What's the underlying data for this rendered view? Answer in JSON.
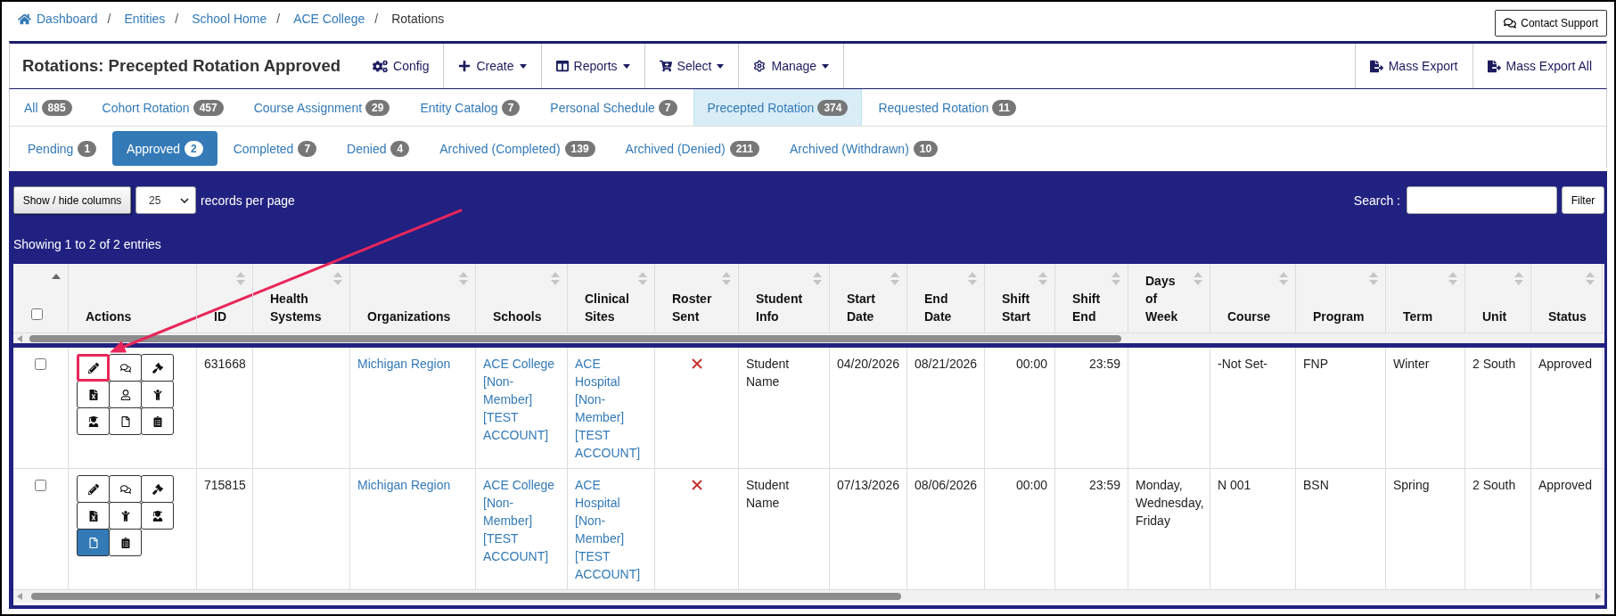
{
  "breadcrumb": [
    {
      "kind": "home",
      "label": "Dashboard"
    },
    {
      "kind": "separator",
      "label": "/"
    },
    {
      "kind": "link",
      "label": "Entities"
    },
    {
      "kind": "separator",
      "label": "/"
    },
    {
      "kind": "link",
      "label": "School Home"
    },
    {
      "kind": "separator",
      "label": "/"
    },
    {
      "kind": "link",
      "label": "ACE College"
    },
    {
      "kind": "separator",
      "label": "/"
    },
    {
      "kind": "current",
      "label": "Rotations"
    }
  ],
  "contact_support": {
    "label": "Contact Support"
  },
  "toolbar": {
    "title": "Rotations: Precepted Rotation Approved",
    "menus": [
      {
        "kind": "config",
        "label": "Config",
        "dropdown": false
      },
      {
        "kind": "create",
        "label": "Create",
        "dropdown": true
      },
      {
        "kind": "reports",
        "label": "Reports",
        "dropdown": true
      },
      {
        "kind": "select",
        "label": "Select",
        "dropdown": true
      },
      {
        "kind": "manage",
        "label": "Manage",
        "dropdown": true
      }
    ],
    "exports": [
      {
        "label": "Mass Export"
      },
      {
        "label": "Mass Export All"
      }
    ]
  },
  "type_tabs": [
    {
      "label": "All",
      "count": "885",
      "selected": false
    },
    {
      "label": "Cohort Rotation",
      "count": "457",
      "selected": false
    },
    {
      "label": "Course Assignment",
      "count": "29",
      "selected": false
    },
    {
      "label": "Entity Catalog",
      "count": "7",
      "selected": false
    },
    {
      "label": "Personal Schedule",
      "count": "7",
      "selected": false
    },
    {
      "label": "Precepted Rotation",
      "count": "374",
      "selected": true
    },
    {
      "label": "Requested Rotation",
      "count": "11",
      "selected": false
    }
  ],
  "status_tabs": [
    {
      "label": "Pending",
      "count": "1",
      "selected": false
    },
    {
      "label": "Approved",
      "count": "2",
      "selected": true
    },
    {
      "label": "Completed",
      "count": "7",
      "selected": false
    },
    {
      "label": "Denied",
      "count": "4",
      "selected": false
    },
    {
      "label": "Archived (Completed)",
      "count": "139",
      "selected": false
    },
    {
      "label": "Archived (Denied)",
      "count": "211",
      "selected": false
    },
    {
      "label": "Archived (Withdrawn)",
      "count": "10",
      "selected": false
    }
  ],
  "table_controls": {
    "columns_button": "Show / hide columns",
    "page_size": "25",
    "page_size_label": "records per page",
    "search_label": "Search :",
    "filter_button": "Filter"
  },
  "info": "Showing 1 to 2 of 2 entries",
  "table": {
    "select_all": {
      "checked": false,
      "sorted": true
    },
    "columns": [
      {
        "label": "Actions",
        "sortable": false,
        "sorted": false
      },
      {
        "label": "ID",
        "sortable": true,
        "sorted": false
      },
      {
        "label": "Health Systems",
        "sortable": true,
        "sorted": false
      },
      {
        "label": "Organizations",
        "sortable": true,
        "sorted": false
      },
      {
        "label": "Schools",
        "sortable": true,
        "sorted": false
      },
      {
        "label": "Clinical Sites",
        "sortable": true,
        "sorted": false
      },
      {
        "label": "Roster Sent",
        "sortable": true,
        "sorted": false
      },
      {
        "label": "Student Info",
        "sortable": true,
        "sorted": false
      },
      {
        "label": "Start Date",
        "sortable": true,
        "sorted": false
      },
      {
        "label": "End Date",
        "sortable": true,
        "sorted": false
      },
      {
        "label": "Shift Start",
        "sortable": true,
        "sorted": false
      },
      {
        "label": "Shift End",
        "sortable": true,
        "sorted": false
      },
      {
        "label": "Days of Week",
        "sortable": true,
        "sorted": false
      },
      {
        "label": "Course",
        "sortable": true,
        "sorted": false
      },
      {
        "label": "Program",
        "sortable": true,
        "sorted": false
      },
      {
        "label": "Term",
        "sortable": true,
        "sorted": false
      },
      {
        "label": "Unit",
        "sortable": true,
        "sorted": false
      },
      {
        "label": "Status",
        "sortable": true,
        "sorted": false
      }
    ],
    "rows": [
      {
        "checked": false,
        "actions": [
          {
            "kind": "edit",
            "active": false,
            "highlighted": true
          },
          {
            "kind": "comments",
            "active": false,
            "highlighted": false
          },
          {
            "kind": "gavel",
            "active": false,
            "highlighted": false
          },
          {
            "kind": "excel",
            "active": false,
            "highlighted": false
          },
          {
            "kind": "user",
            "active": false,
            "highlighted": false
          },
          {
            "kind": "child",
            "active": false,
            "highlighted": false
          },
          {
            "kind": "graduate",
            "active": false,
            "highlighted": false
          },
          {
            "kind": "file",
            "active": false,
            "highlighted": false
          },
          {
            "kind": "clipboard",
            "active": false,
            "highlighted": false
          }
        ],
        "id": "631668",
        "organization": "Michigan Region",
        "school": "ACE College [Non-Member] [TEST ACCOUNT]",
        "clinical_site": "ACE Hospital [Non-Member] [TEST ACCOUNT]",
        "roster_sent": false,
        "student_info": "Student Name",
        "start_date": "04/20/2026",
        "end_date": "08/21/2026",
        "shift_start": "00:00",
        "shift_end": "23:59",
        "course": "-Not Set-",
        "program": "FNP",
        "term": "Winter",
        "unit": "2 South",
        "status": "Approved"
      },
      {
        "checked": false,
        "actions": [
          {
            "kind": "edit",
            "active": false,
            "highlighted": false
          },
          {
            "kind": "comments",
            "active": false,
            "highlighted": false
          },
          {
            "kind": "gavel",
            "active": false,
            "highlighted": false
          },
          {
            "kind": "excel",
            "active": false,
            "highlighted": false
          },
          {
            "kind": "child",
            "active": false,
            "highlighted": false
          },
          {
            "kind": "graduate",
            "active": false,
            "highlighted": false
          },
          {
            "kind": "file",
            "active": true,
            "highlighted": false
          },
          {
            "kind": "clipboard",
            "active": false,
            "highlighted": false
          }
        ],
        "id": "715815",
        "organization": "Michigan Region",
        "school": "ACE College [Non-Member] [TEST ACCOUNT]",
        "clinical_site": "ACE Hospital [Non-Member] [TEST ACCOUNT]",
        "roster_sent": false,
        "student_info": "Student Name",
        "start_date": "07/13/2026",
        "end_date": "08/06/2026",
        "shift_start": "00:00",
        "shift_end": "23:59",
        "days_of_week": "Monday, Wednesday, Friday",
        "course": "N 001",
        "program": "BSN",
        "term": "Spring",
        "unit": "2 South",
        "status": "Approved"
      }
    ]
  }
}
